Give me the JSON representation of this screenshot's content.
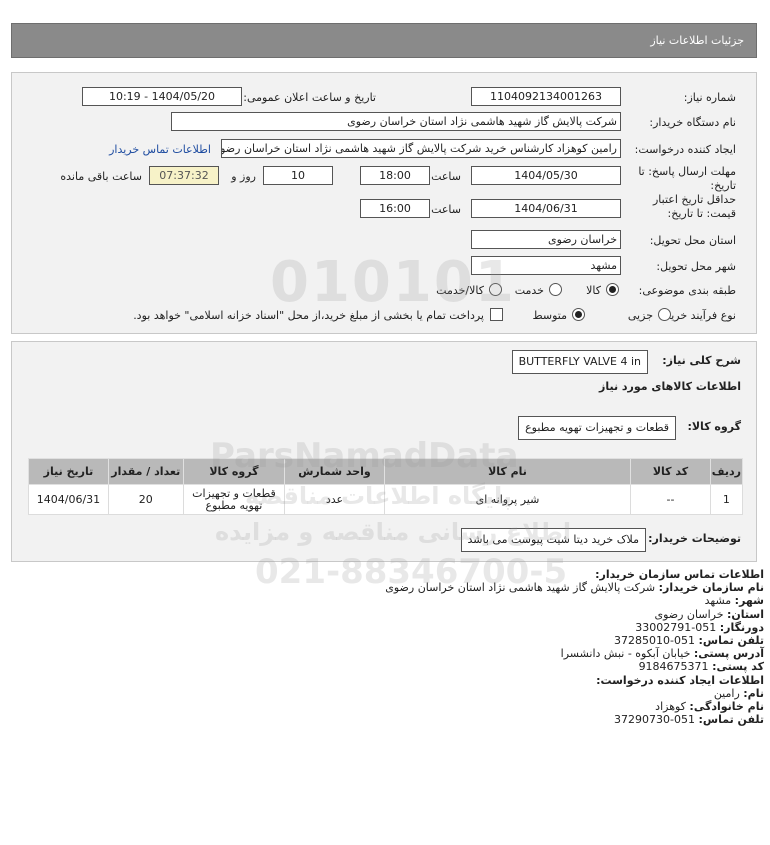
{
  "header": {
    "title": "جزئیات اطلاعات نیاز"
  },
  "fields": {
    "need_number_label": "شماره نیاز:",
    "need_number": "1104092134001263",
    "announce_label": "تاریخ و ساعت اعلان عمومی:",
    "announce_value": "1404/05/20 - 10:19",
    "buyer_org_label": "نام دستگاه خریدار:",
    "buyer_org": "شرکت پالایش گاز شهید هاشمی نژاد   استان خراسان رضوی",
    "creator_label": "ایجاد کننده درخواست:",
    "creator": "رامین کوهزاد کارشناس خرید شرکت پالایش گاز شهید هاشمی نژاد   استان خراسان رضوی",
    "contact_link": "اطلاعات تماس خریدار",
    "deadline_label": "مهلت ارسال پاسخ: تا تاریخ:",
    "deadline_date": "1404/05/30",
    "time_label": "ساعت",
    "deadline_time": "18:00",
    "days": "10",
    "days_label": "روز و",
    "remaining_time": "07:37:32",
    "remaining_label": "ساعت باقی مانده",
    "validity_label": "حداقل تاریخ اعتبار قیمت: تا تاریخ:",
    "validity_date": "1404/06/31",
    "validity_time": "16:00",
    "province_label": "استان محل تحویل:",
    "province": "خراسان رضوی",
    "city_label": "شهر محل تحویل:",
    "city": "مشهد",
    "category_label": "طبقه بندی موضوعی:",
    "category_options": [
      "کالا",
      "خدمت",
      "کالا/خدمت"
    ],
    "category_selected": "کالا",
    "process_label": "نوع فرآیند خرید :",
    "process_options": [
      "جزیی",
      "متوسط"
    ],
    "process_selected": "متوسط",
    "payment_note": "پرداخت تمام یا بخشی از مبلغ خرید،از محل \"اسناد خزانه اسلامی\" خواهد بود."
  },
  "description": {
    "need_desc_label": "شرح کلی نیاز:",
    "need_desc": "BUTTERFLY VALVE 4 in",
    "goods_info_label": "اطلاعات کالاهای مورد نیاز",
    "goods_group_label": "گروه کالا:",
    "goods_group": "قطعات و تجهیزات تهویه مطبوع",
    "table": {
      "headers": [
        "ردیف",
        "کد کالا",
        "نام کالا",
        "واحد شمارش",
        "گروه کالا",
        "تعداد / مقدار",
        "تاریخ نیاز"
      ],
      "rows": [
        [
          "1",
          "--",
          "شیر پروانه ای",
          "عدد",
          "قطعات و تجهیزات تهویه مطبوع",
          "20",
          "1404/06/31"
        ]
      ]
    },
    "buyer_notes_label": "توضیحات خریدار:",
    "buyer_notes": "ملاک خرید دیتا شیت پیوست می باشد"
  },
  "contact": {
    "org_title": "اطلاعات تماس سازمان خریدار:",
    "org_name_label": "نام سازمان خریدار:",
    "org_name": "شرکت پالایش گاز شهید هاشمی نژاد استان خراسان رضوی",
    "city_label": "شهر:",
    "city": "مشهد",
    "province_label": "استان:",
    "province": "خراسان رضوی",
    "fax_label": "دورنگار:",
    "fax": "051-33002791",
    "phone_label": "تلفن تماس:",
    "phone": "051-37285010",
    "address_label": "آدرس پستی:",
    "address": "خیابان آبکوه - نبش دانشسرا",
    "postal_label": "کد پستی:",
    "postal": "9184675371",
    "creator_title": "اطلاعات ایجاد کننده درخواست:",
    "first_name_label": "نام:",
    "first_name": "رامین",
    "last_name_label": "نام خانوادگی:",
    "last_name": "کوهزاد",
    "creator_phone_label": "تلفن تماس:",
    "creator_phone": "051-37290730"
  },
  "watermark": {
    "brand": "ParsNamadData",
    "line1": "پایگاه اطلاعات مناقصه",
    "line2": "اطلاع رسانی مناقصه و مزایده",
    "phone": "021-88346700-5"
  }
}
